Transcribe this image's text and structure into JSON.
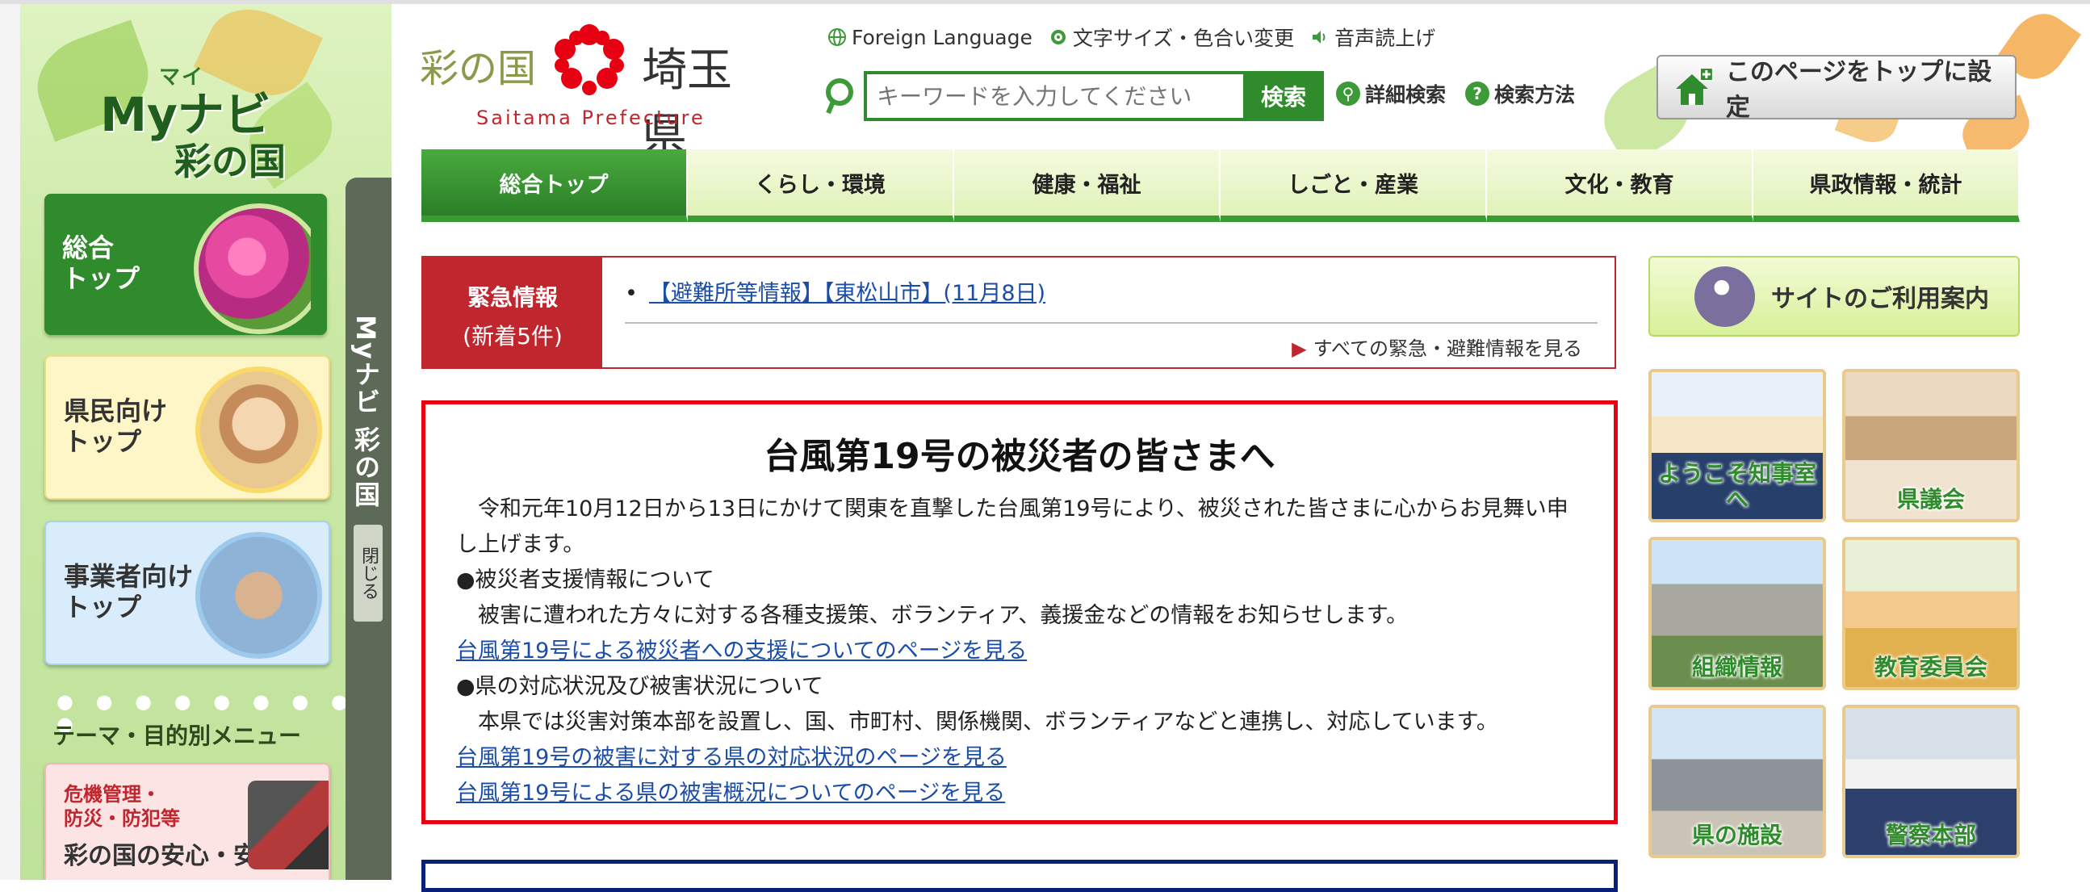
{
  "sidebar": {
    "logo": {
      "ruby": "マイ",
      "main": "Myナビ",
      "sub": "彩の国"
    },
    "cards": {
      "top": {
        "line1": "総合",
        "line2": "トップ"
      },
      "kenmin": {
        "line1": "県民向け",
        "line2": "トップ"
      },
      "jigyo": {
        "line1": "事業者向け",
        "line2": "トップ"
      }
    },
    "theme_menu_label": "テーマ・目的別メニュー",
    "kiki": {
      "line1": "危機管理・",
      "line2": "防災・防犯等",
      "big": "彩の国の安心・安全"
    },
    "tab_label": "Myナビ 彩の国",
    "close_label": "閉じる"
  },
  "header": {
    "logo_irodori": "彩の国",
    "logo_pref": "埼玉県",
    "logo_en": "Saitama Prefecture",
    "util": {
      "foreign": "Foreign Language",
      "font_size": "文字サイズ・色合い変更",
      "voice": "音声読上げ"
    },
    "search": {
      "placeholder": "キーワードを入力してください",
      "button": "検索",
      "advanced": "詳細検索",
      "howto": "検索方法"
    },
    "set_top": "このページをトップに設定"
  },
  "gnav": [
    "総合トップ",
    "くらし・環境",
    "健康・福祉",
    "しごと・産業",
    "文化・教育",
    "県政情報・統計"
  ],
  "emergency": {
    "label1": "緊急情報",
    "label2": "(新着5件)",
    "link": "【避難所等情報】【東松山市】(11月8日)",
    "all": "すべての緊急・避難情報を見る"
  },
  "notice": {
    "title": "台風第19号の被災者の皆さまへ",
    "intro": "　令和元年10月12日から13日にかけて関東を直撃した台風第19号により、被災された皆さまに心からお見舞い申し上げます。",
    "h1": "●被災者支援情報について",
    "p1": "　被害に遭われた方々に対する各種支援策、ボランティア、義援金などの情報をお知らせします。",
    "link1": "台風第19号による被災者への支援についてのページを見る",
    "h2": "●県の対応状況及び被害状況について",
    "p2": "　本県では災害対策本部を設置し、国、市町村、関係機関、ボランティアなどと連携し、対応しています。",
    "link2": "台風第19号の被害に対する県の対応状況のページを見る",
    "link3": "台風第19号による県の被害概況についてのページを見る"
  },
  "right": {
    "guide": "サイトのご利用案内",
    "tiles": [
      "ようこそ知事室へ",
      "県議会",
      "組織情報",
      "教育委員会",
      "県の施設",
      "警察本部"
    ]
  },
  "colors": {
    "accent_green": "#2f8b2c",
    "alert_red": "#c0262d",
    "notice_red": "#e60012",
    "link_blue": "#1a4da8"
  }
}
